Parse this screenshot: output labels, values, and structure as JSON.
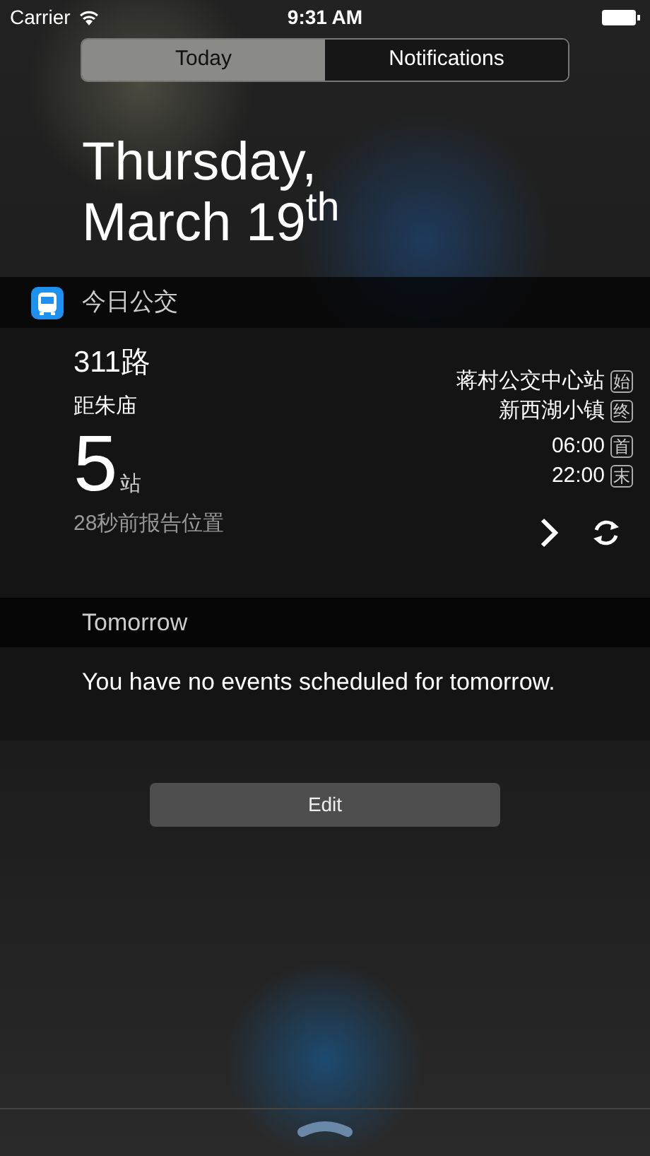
{
  "status_bar": {
    "carrier": "Carrier",
    "time": "9:31 AM"
  },
  "tabs": [
    {
      "label": "Today",
      "selected": true
    },
    {
      "label": "Notifications",
      "selected": false
    }
  ],
  "date": {
    "weekday": "Thursday,",
    "day": "March 19$^{th}$"
  },
  "widget": {
    "title": "今日公交",
    "route": "311路",
    "distance_label": "距朱庙",
    "stops_count": "5",
    "stops_unit": "站",
    "reported": "28秒前报告位置",
    "terminals": [
      {
        "name": "蒋村公交中心站",
        "tag": "始"
      },
      {
        "name": "新西湖小镇",
        "tag": "终"
      }
    ],
    "service_times": [
      {
        "time": "06:00",
        "tag": "首"
      },
      {
        "time": "22:00",
        "tag": "末"
      }
    ]
  },
  "tomorrow": {
    "title": "Tomorrow",
    "message": "You have no events scheduled for tomorrow."
  },
  "edit_button": "Edit"
}
